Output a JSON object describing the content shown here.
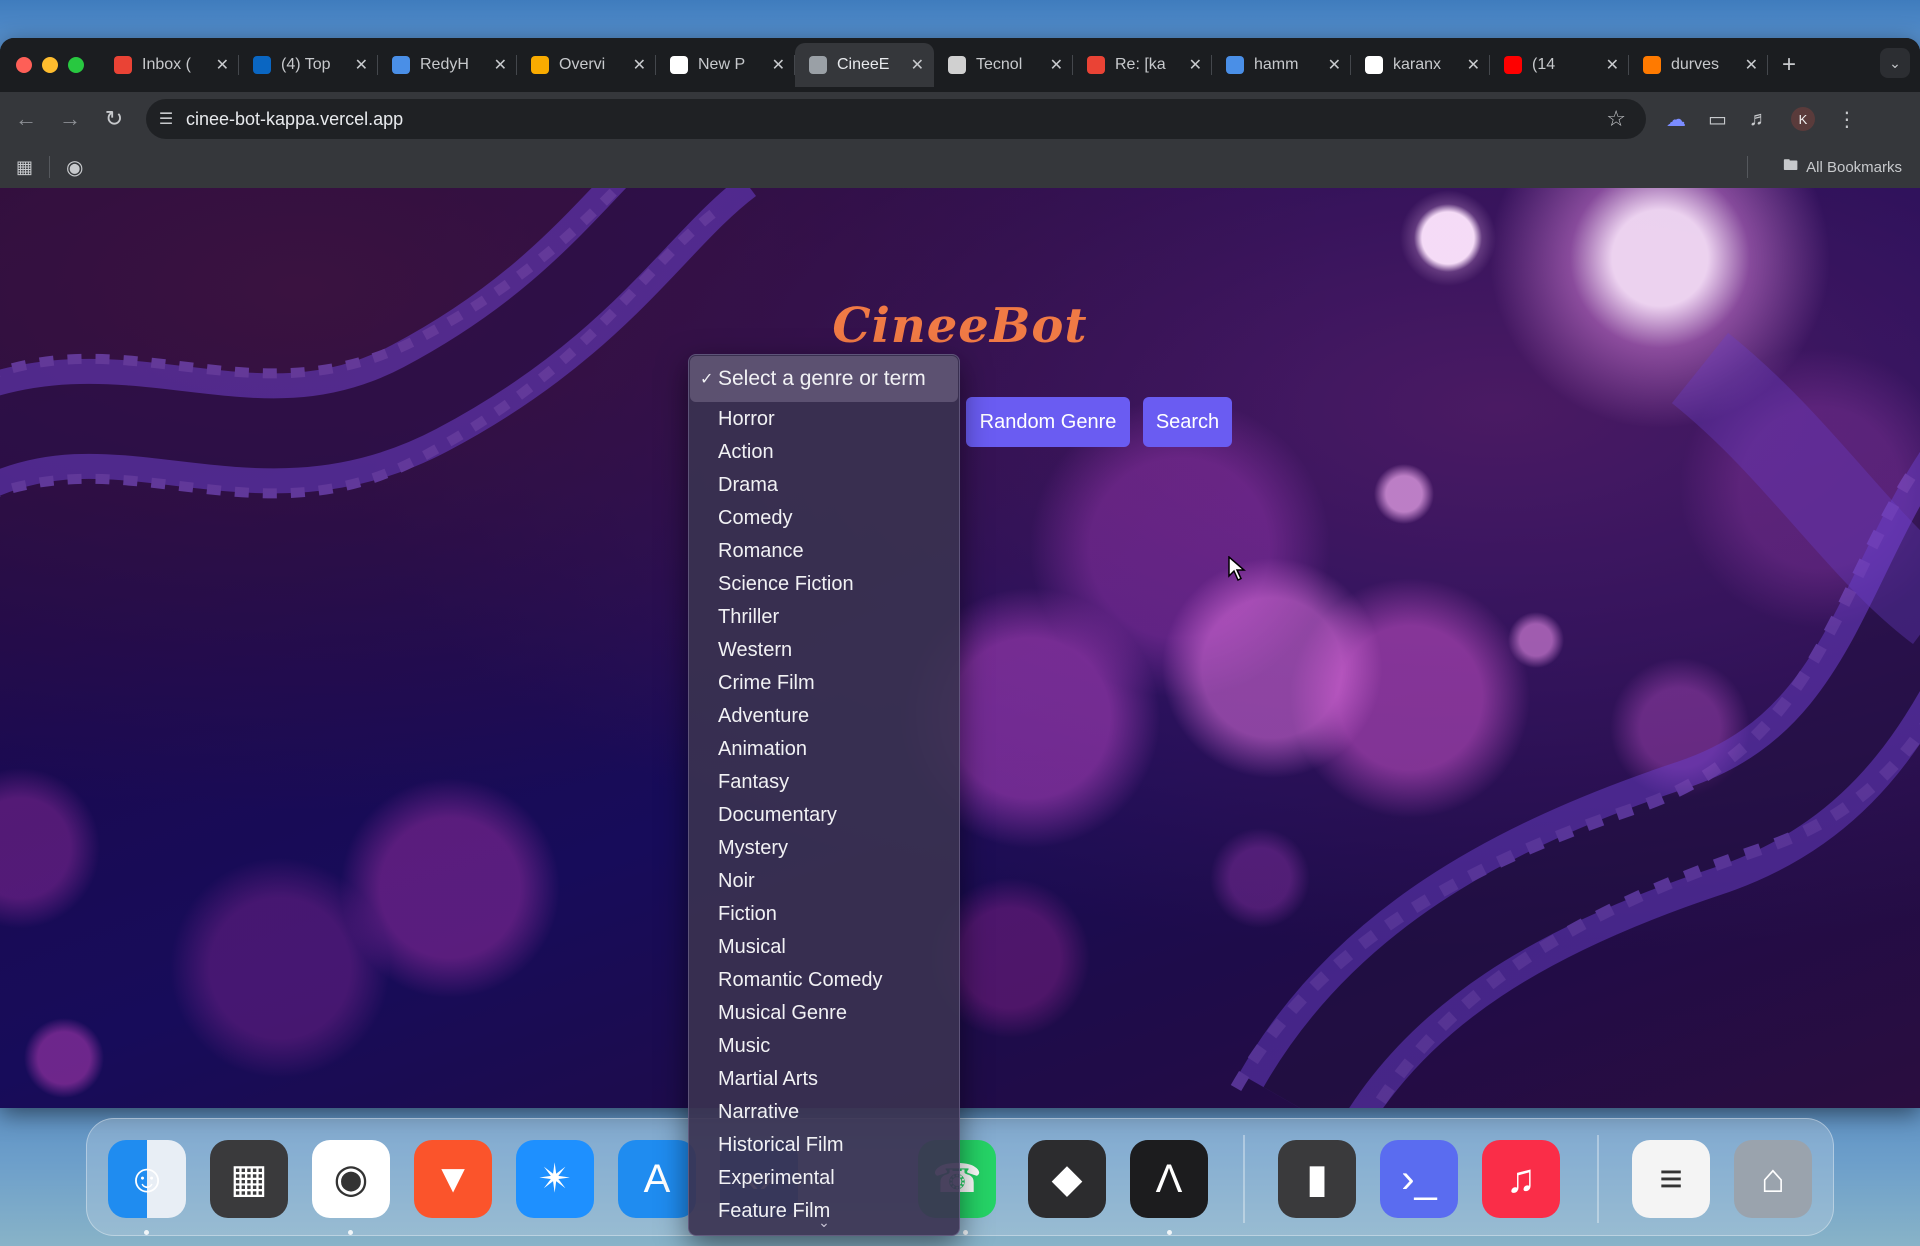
{
  "browser": {
    "tabs": [
      {
        "title": "Inbox (",
        "favicon": "gmail-icon",
        "color": "#ea4335",
        "active": false
      },
      {
        "title": "(4) Top",
        "favicon": "linkedin-icon",
        "color": "#0a66c2",
        "active": false
      },
      {
        "title": "RedyH",
        "favicon": "location-pin-icon",
        "color": "#4a8fe7",
        "active": false
      },
      {
        "title": "Overvi",
        "favicon": "analytics-icon",
        "color": "#f9ab00",
        "active": false
      },
      {
        "title": "New P",
        "favicon": "triangle-icon",
        "color": "#ffffff",
        "active": false
      },
      {
        "title": "CineeE",
        "favicon": "globe-icon",
        "color": "#9aa0a6",
        "active": true
      },
      {
        "title": "Tecnol",
        "favicon": "openai-icon",
        "color": "#d0d0d0",
        "active": false
      },
      {
        "title": "Re: [ka",
        "favicon": "gmail-icon",
        "color": "#ea4335",
        "active": false
      },
      {
        "title": "hamm",
        "favicon": "loading-icon",
        "color": "#4a8fe7",
        "active": false
      },
      {
        "title": "karanx",
        "favicon": "github-icon",
        "color": "#ffffff",
        "active": false
      },
      {
        "title": "(14",
        "favicon": "youtube-icon",
        "color": "#ff0000",
        "active": false
      },
      {
        "title": "durves",
        "favicon": "flame-icon",
        "color": "#ff7a00",
        "active": false
      }
    ],
    "url": "cinee-bot-kappa.vercel.app",
    "profile_initial": "K",
    "bookmarks_label": "All Bookmarks"
  },
  "page": {
    "title": "CineeBot",
    "select": {
      "selected": "Select a genre or term",
      "options": [
        "Horror",
        "Action",
        "Drama",
        "Comedy",
        "Romance",
        "Science Fiction",
        "Thriller",
        "Western",
        "Crime Film",
        "Adventure",
        "Animation",
        "Fantasy",
        "Documentary",
        "Mystery",
        "Noir",
        "Fiction",
        "Musical",
        "Romantic Comedy",
        "Musical Genre",
        "Music",
        "Martial Arts",
        "Narrative",
        "Historical Film",
        "Experimental",
        "Feature Film"
      ]
    },
    "random_button": "Random Genre",
    "search_button": "Search",
    "accent_color": "#6a5cf2",
    "title_color": "#f07a45"
  },
  "dock": {
    "apps": [
      "finder-icon",
      "launchpad-icon",
      "chrome-icon",
      "brave-icon",
      "safari-icon",
      "app-store-icon",
      "vscode-icon",
      "whatsapp-icon",
      "cube-icon",
      "arc-icon",
      "jar-icon",
      "terminal-icon",
      "music-icon",
      "document-icon",
      "trash-icon"
    ]
  }
}
